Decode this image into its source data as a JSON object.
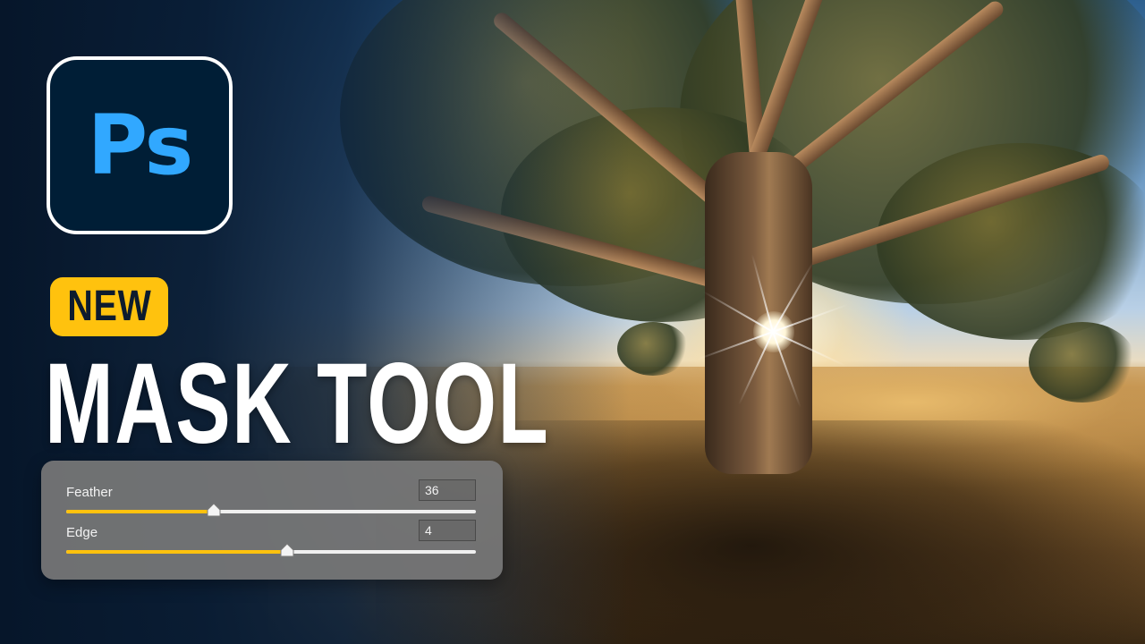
{
  "logo": {
    "text": "Ps",
    "icon": "photoshop-app-icon",
    "color": "#31a8ff",
    "background": "#001e36"
  },
  "badge": {
    "text": "NEW",
    "color": "#ffc20e"
  },
  "headline": {
    "text": "MASK TOOL"
  },
  "panel": {
    "sliders": [
      {
        "label": "Feather",
        "value": "36",
        "level": 0.36
      },
      {
        "label": "Edge",
        "value": "4",
        "level": 0.54
      }
    ],
    "accent": "#ffc20e"
  }
}
